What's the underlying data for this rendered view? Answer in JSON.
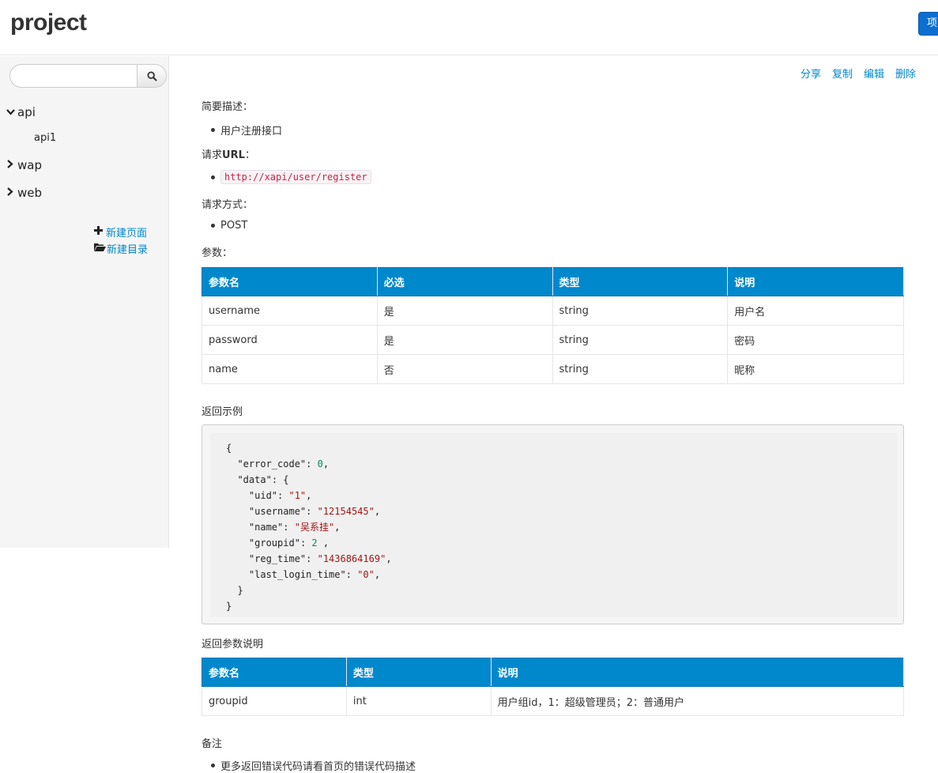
{
  "header": {
    "logo": "project",
    "top_button": "项"
  },
  "sidebar": {
    "search_placeholder": "",
    "tree": [
      {
        "label": "api",
        "expanded": true,
        "children": [
          "api1"
        ]
      },
      {
        "label": "wap",
        "expanded": false
      },
      {
        "label": "web",
        "expanded": false
      }
    ],
    "new_page": "新建页面",
    "new_dir": "新建目录"
  },
  "actions": {
    "share": "分享",
    "copy": "复制",
    "edit": "编辑",
    "delete": "删除"
  },
  "doc": {
    "brief_label": "简要描述：",
    "brief_value": "用户注册接口",
    "url_label_prefix": "请求",
    "url_label_strong": "URL",
    "url_label_suffix": "：",
    "url_value": "http://xapi/user/register",
    "method_label": "请求方式：",
    "method_value": "POST",
    "params_label": "参数：",
    "params_table": {
      "headers": [
        "参数名",
        "必选",
        "类型",
        "说明"
      ],
      "rows": [
        [
          "username",
          "是",
          "string",
          "用户名"
        ],
        [
          "password",
          "是",
          "string",
          "密码"
        ],
        [
          "name",
          "否",
          "string",
          "昵称"
        ]
      ]
    },
    "return_example_label": "返回示例",
    "json_lines": {
      "l1": "{",
      "error_code_key": "\"error_code\"",
      "error_code_val": "0",
      "data_key": "\"data\"",
      "data_open": "{",
      "uid_key": "\"uid\"",
      "uid_val": "\"1\"",
      "username_key": "\"username\"",
      "username_val": "\"12154545\"",
      "name_key": "\"name\"",
      "name_val": "\"吴系挂\"",
      "groupid_key": "\"groupid\"",
      "groupid_val": "2",
      "reg_time_key": "\"reg_time\"",
      "reg_time_val": "\"1436864169\"",
      "last_login_key": "\"last_login_time\"",
      "last_login_val": "\"0\"",
      "data_close": "}",
      "end": "}"
    },
    "return_params_label": "返回参数说明",
    "return_table": {
      "headers": [
        "参数名",
        "类型",
        "说明"
      ],
      "rows": [
        [
          "groupid",
          "int",
          "用户组id，1：超级管理员；2：普通用户"
        ]
      ]
    },
    "remark_label": "备注",
    "remark_value": "更多返回错误代码请看首页的错误代码描述"
  }
}
